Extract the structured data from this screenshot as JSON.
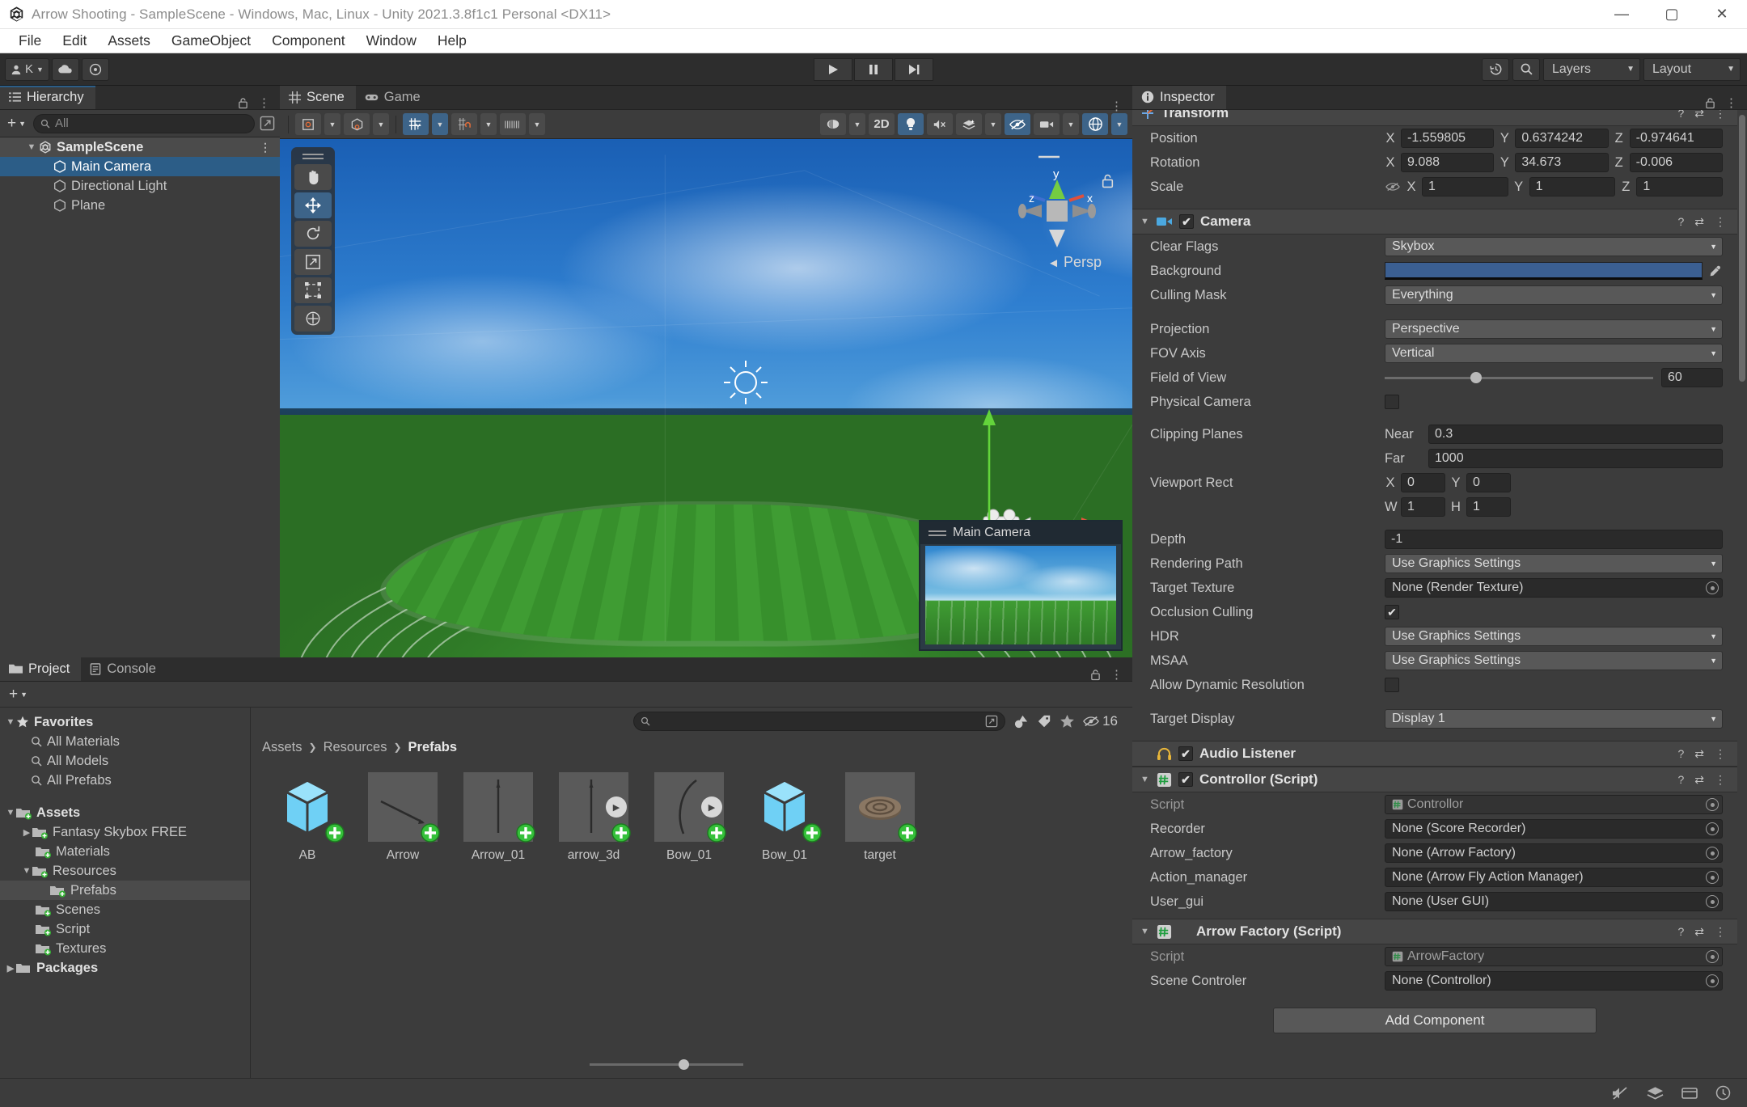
{
  "window": {
    "title": "Arrow Shooting - SampleScene - Windows, Mac, Linux - Unity 2021.3.8f1c1 Personal <DX11>",
    "minimize": "—",
    "maximize": "▢",
    "close": "✕"
  },
  "menubar": {
    "items": [
      "File",
      "Edit",
      "Assets",
      "GameObject",
      "Component",
      "Window",
      "Help"
    ]
  },
  "toolbar": {
    "account_label": "K",
    "cloud_icon": "cloud-icon",
    "collab_icon": "collab-icon",
    "play": "▶",
    "pause": "❚❚",
    "step": "▶❙",
    "undo_history_icon": "undo-history-icon",
    "search_icon": "search-icon",
    "layers_label": "Layers",
    "layout_label": "Layout"
  },
  "hierarchy": {
    "tab": "Hierarchy",
    "search_placeholder": "All",
    "add_label": "+",
    "items": [
      {
        "label": "SampleScene",
        "depth": 0,
        "type": "scene",
        "selected": false,
        "expanded": true
      },
      {
        "label": "Main Camera",
        "depth": 1,
        "type": "gameobject",
        "selected": true
      },
      {
        "label": "Directional Light",
        "depth": 1,
        "type": "gameobject",
        "selected": false
      },
      {
        "label": "Plane",
        "depth": 1,
        "type": "gameobject",
        "selected": false
      }
    ]
  },
  "scene": {
    "tabs": [
      {
        "label": "Scene",
        "active": true,
        "icon": "grid-icon"
      },
      {
        "label": "Game",
        "active": false,
        "icon": "gamepad-icon"
      }
    ],
    "toolbar": {
      "pivot_label": "pivot-toggle",
      "space_label": "global-toggle",
      "grid_snap_icon": "grid-snap-icon",
      "magnet_icon": "magnet-snap-icon",
      "ruler_icon": "ruler-icon",
      "twod_label": "2D",
      "light_icon": "lighting-icon",
      "audio_icon": "audio-mute-icon",
      "fx_icon": "effects-icon",
      "hidden_icon": "hidden-objects-icon",
      "camera_icon": "scene-camera-icon",
      "gizmos_icon": "gizmos-icon"
    },
    "left_tools": [
      {
        "name": "hand-tool",
        "active": false
      },
      {
        "name": "move-tool",
        "active": true
      },
      {
        "name": "rotate-tool",
        "active": false
      },
      {
        "name": "scale-tool",
        "active": false
      },
      {
        "name": "rect-tool",
        "active": false
      },
      {
        "name": "transform-tool",
        "active": false
      }
    ],
    "gizmo": {
      "y_label": "y",
      "x_label": "x",
      "z_label": "z",
      "persp_label": "Persp"
    },
    "camera_preview": {
      "title": "Main Camera"
    }
  },
  "project": {
    "tabs": [
      {
        "label": "Project",
        "active": true,
        "icon": "folder-icon"
      },
      {
        "label": "Console",
        "active": false,
        "icon": "console-icon"
      }
    ],
    "add_label": "+",
    "search_placeholder": "",
    "filter_icons": [
      "asset-type-filter-icon",
      "label-filter-icon",
      "favorite-filter-icon"
    ],
    "hidden_count": "16",
    "breadcrumb": [
      "Assets",
      "Resources",
      "Prefabs"
    ],
    "tree": [
      {
        "label": "Favorites",
        "depth": 0,
        "type": "star",
        "bold": true,
        "arrow": "down"
      },
      {
        "label": "All Materials",
        "depth": 1,
        "type": "search"
      },
      {
        "label": "All Models",
        "depth": 1,
        "type": "search"
      },
      {
        "label": "All Prefabs",
        "depth": 1,
        "type": "search"
      },
      {
        "label": "",
        "depth": 0,
        "type": "gap"
      },
      {
        "label": "Assets",
        "depth": 0,
        "type": "folder-open",
        "bold": true,
        "arrow": "down"
      },
      {
        "label": "Fantasy Skybox FREE",
        "depth": 1,
        "type": "folder",
        "arrow": "right"
      },
      {
        "label": "Materials",
        "depth": 1,
        "type": "folder"
      },
      {
        "label": "Resources",
        "depth": 1,
        "type": "folder-open",
        "arrow": "down"
      },
      {
        "label": "Prefabs",
        "depth": 2,
        "type": "folder",
        "selected": true
      },
      {
        "label": "Scenes",
        "depth": 1,
        "type": "folder"
      },
      {
        "label": "Script",
        "depth": 1,
        "type": "folder"
      },
      {
        "label": "Textures",
        "depth": 1,
        "type": "folder"
      },
      {
        "label": "Packages",
        "depth": 0,
        "type": "folder-plain",
        "bold": true,
        "arrow": "right"
      }
    ],
    "assets": [
      {
        "name": "AB",
        "thumb": "prefab-cube",
        "prefab": true,
        "play": false
      },
      {
        "name": "Arrow",
        "thumb": "arrow-diagonal",
        "prefab": true,
        "play": false
      },
      {
        "name": "Arrow_01",
        "thumb": "arrow-vertical",
        "prefab": true,
        "play": false
      },
      {
        "name": "arrow_3d",
        "thumb": "arrow-vertical",
        "prefab": true,
        "play": true
      },
      {
        "name": "Bow_01",
        "thumb": "bow-curve",
        "prefab": true,
        "play": true
      },
      {
        "name": "Bow_01",
        "thumb": "prefab-cube",
        "prefab": true,
        "play": false
      },
      {
        "name": "target",
        "thumb": "target-disc",
        "prefab": true,
        "play": false
      }
    ]
  },
  "inspector": {
    "tab": "Inspector",
    "transform": {
      "title": "Transform",
      "rows": [
        {
          "label": "Position",
          "x": "-1.559805",
          "y": "0.6374242",
          "z": "-0.974641"
        },
        {
          "label": "Rotation",
          "x": "9.088",
          "y": "34.673",
          "z": "-0.006"
        },
        {
          "label": "Scale",
          "x": "1",
          "y": "1",
          "z": "1",
          "constrain_icon": "constrain-proportions-icon"
        }
      ],
      "axis_labels": [
        "X",
        "Y",
        "Z"
      ]
    },
    "camera": {
      "title": "Camera",
      "enabled": true,
      "icon": "camera-icon",
      "fields": [
        {
          "label": "Clear Flags",
          "kind": "dropdown",
          "value": "Skybox"
        },
        {
          "label": "Background",
          "kind": "color",
          "value": "#3b5f92"
        },
        {
          "label": "Culling Mask",
          "kind": "dropdown",
          "value": "Everything"
        },
        {
          "label": "",
          "kind": "gap"
        },
        {
          "label": "Projection",
          "kind": "dropdown",
          "value": "Perspective"
        },
        {
          "label": "FOV Axis",
          "kind": "dropdown",
          "value": "Vertical"
        },
        {
          "label": "Field of View",
          "kind": "slider",
          "value": "60"
        },
        {
          "label": "Physical Camera",
          "kind": "checkbox",
          "checked": false
        },
        {
          "label": "",
          "kind": "gap"
        },
        {
          "label": "Clipping Planes",
          "kind": "sublabel",
          "sub": "Near",
          "value": "0.3"
        },
        {
          "label": "",
          "kind": "sublabel",
          "sub": "Far",
          "value": "1000"
        },
        {
          "label": "Viewport Rect",
          "kind": "rect2",
          "ax": "X",
          "av": "0",
          "bx": "Y",
          "bv": "0"
        },
        {
          "label": "",
          "kind": "rect2",
          "ax": "W",
          "av": "1",
          "bx": "H",
          "bv": "1"
        },
        {
          "label": "",
          "kind": "gap"
        },
        {
          "label": "Depth",
          "kind": "input",
          "value": "-1"
        },
        {
          "label": "Rendering Path",
          "kind": "dropdown",
          "value": "Use Graphics Settings"
        },
        {
          "label": "Target Texture",
          "kind": "object",
          "value": "None (Render Texture)"
        },
        {
          "label": "Occlusion Culling",
          "kind": "checkbox",
          "checked": true
        },
        {
          "label": "HDR",
          "kind": "dropdown",
          "value": "Use Graphics Settings"
        },
        {
          "label": "MSAA",
          "kind": "dropdown",
          "value": "Use Graphics Settings"
        },
        {
          "label": "Allow Dynamic Resolution",
          "kind": "checkbox",
          "checked": false
        },
        {
          "label": "",
          "kind": "gap"
        },
        {
          "label": "Target Display",
          "kind": "dropdown",
          "value": "Display 1"
        }
      ]
    },
    "audio_listener": {
      "title": "Audio Listener",
      "enabled": true,
      "icon": "headphones-icon"
    },
    "controller_script": {
      "title": "Controllor (Script)",
      "enabled": true,
      "icon": "script-icon",
      "fields": [
        {
          "label": "Script",
          "value": "Controllor",
          "dim": true,
          "script": true
        },
        {
          "label": "Recorder",
          "value": "None (Score Recorder)"
        },
        {
          "label": "Arrow_factory",
          "value": "None (Arrow Factory)"
        },
        {
          "label": "Action_manager",
          "value": "None (Arrow Fly Action Manager)"
        },
        {
          "label": "User_gui",
          "value": "None (User GUI)"
        }
      ]
    },
    "arrow_factory_script": {
      "title": "Arrow Factory (Script)",
      "enabled": true,
      "icon": "script-icon",
      "fields": [
        {
          "label": "Script",
          "value": "ArrowFactory",
          "dim": true,
          "script": true
        },
        {
          "label": "Scene Controler",
          "value": "None (Controllor)"
        }
      ]
    },
    "add_component": "Add Component",
    "header_icons": [
      "help-icon",
      "preset-icon",
      "kebab-icon"
    ]
  },
  "statusbar": {
    "icons": [
      "mute-audio-icon",
      "layers-status-icon",
      "preview-pack-icon",
      "api-updater-icon"
    ]
  }
}
